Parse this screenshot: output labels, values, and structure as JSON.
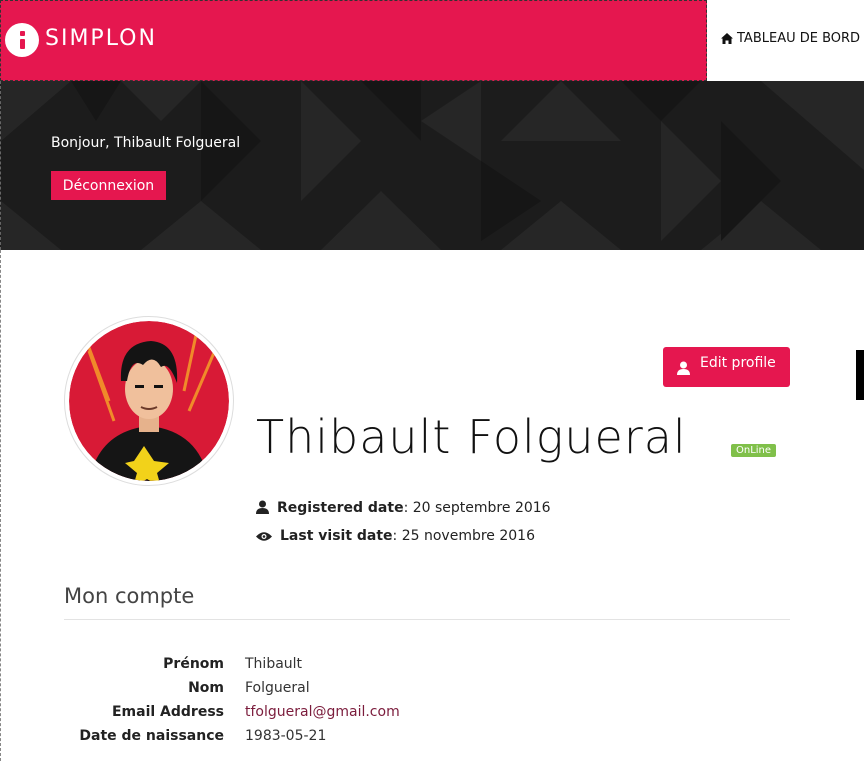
{
  "brand": {
    "name": "SIMPLON",
    "icon": "simplon-logo-icon",
    "color": "#e5174f"
  },
  "nav": {
    "dashboard_label": "TABLEAU DE BORD",
    "dashboard_icon": "home-icon"
  },
  "hero": {
    "greeting": "Bonjour, Thibault Folgueral",
    "logout_label": "Déconnexion"
  },
  "profile": {
    "name": "Thibault Folgueral",
    "status": "OnLine",
    "edit_label": "Edit profile",
    "registered_label": "Registered date",
    "registered_value": "20 septembre 2016",
    "last_visit_label": "Last visit date",
    "last_visit_value": "25 novembre 2016",
    "status_color": "#80c04a"
  },
  "account": {
    "title": "Mon compte",
    "fields": [
      {
        "label": "Prénom",
        "value": "Thibault"
      },
      {
        "label": "Nom",
        "value": "Folgueral"
      },
      {
        "label": "Email Address",
        "value": "tfolgueral@gmail.com"
      },
      {
        "label": "Date de naissance",
        "value": "1983-05-21"
      }
    ]
  }
}
